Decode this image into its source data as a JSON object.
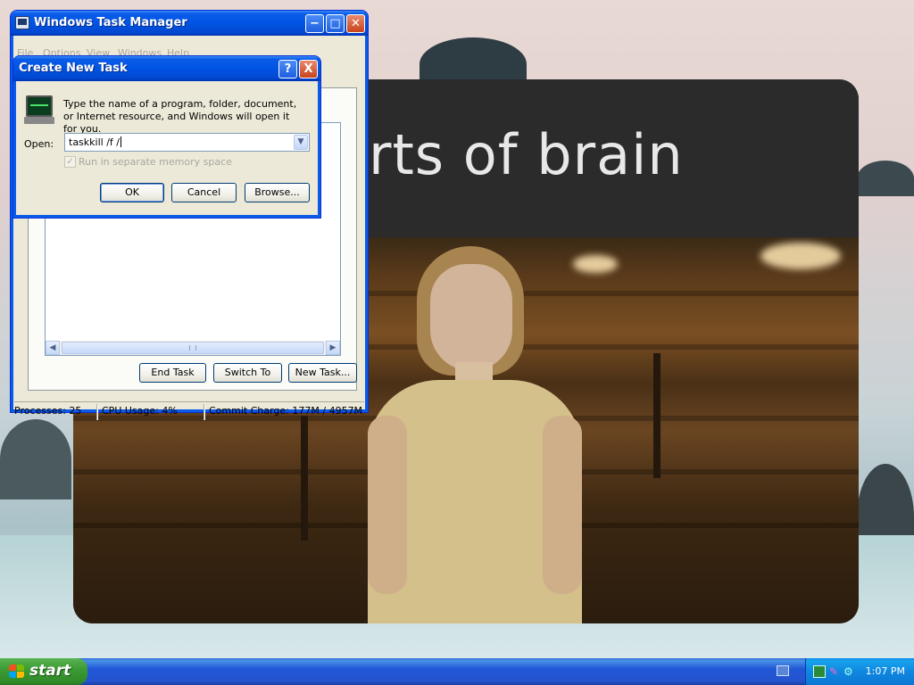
{
  "task_manager": {
    "title": "Windows Task Manager",
    "menu": [
      "File",
      "Options",
      "View",
      "Windows",
      "Help"
    ],
    "buttons": {
      "end_task": "End Task",
      "switch_to": "Switch To",
      "new_task": "New Task..."
    },
    "status": {
      "processes": "Processes: 25",
      "cpu": "CPU Usage: 4%",
      "commit": "Commit Charge: 177M / 4957M"
    }
  },
  "create_task_dialog": {
    "title": "Create New Task",
    "help_symbol": "?",
    "close_symbol": "X",
    "description": "Type the name of a program, folder, document, or Internet resource, and Windows will open it for you.",
    "open_label": "Open:",
    "open_value": "taskkill /f /",
    "checkbox_label": "Run in separate memory space",
    "checkbox_checked": true,
    "buttons": {
      "ok": "OK",
      "cancel": "Cancel",
      "browse": "Browse..."
    }
  },
  "viewer": {
    "title_text": "arts of brain"
  },
  "taskbar": {
    "start_label": "start",
    "clock": "1:07 PM"
  },
  "colors": {
    "xp_blue": "#0054e3",
    "start_green": "#3c9c34",
    "tray_blue": "#0f87e0"
  }
}
